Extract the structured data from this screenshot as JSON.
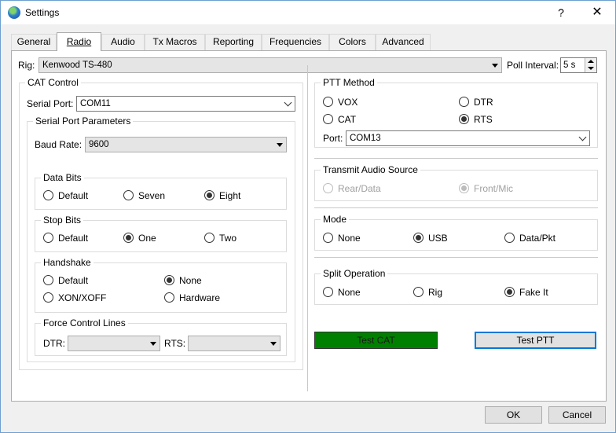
{
  "window": {
    "title": "Settings",
    "help": "?",
    "close": "✕"
  },
  "tabs": [
    "General",
    "Radio",
    "Audio",
    "Tx Macros",
    "Reporting",
    "Frequencies",
    "Colors",
    "Advanced"
  ],
  "rig": {
    "label": "Rig:",
    "value": "Kenwood TS-480"
  },
  "poll": {
    "label": "Poll Interval:",
    "value": "5 s"
  },
  "cat": {
    "title": "CAT Control",
    "serial_port_label": "Serial Port:",
    "serial_port_value": "COM11",
    "params_title": "Serial Port Parameters",
    "baud_label": "Baud Rate:",
    "baud_value": "9600",
    "data_bits": {
      "title": "Data Bits",
      "options": [
        "Default",
        "Seven",
        "Eight"
      ],
      "selected": "Eight"
    },
    "stop_bits": {
      "title": "Stop Bits",
      "options": [
        "Default",
        "One",
        "Two"
      ],
      "selected": "One"
    },
    "handshake": {
      "title": "Handshake",
      "options": [
        "Default",
        "None",
        "XON/XOFF",
        "Hardware"
      ],
      "selected": "None"
    },
    "force": {
      "title": "Force Control Lines",
      "dtr_label": "DTR:",
      "dtr_value": "",
      "rts_label": "RTS:",
      "rts_value": ""
    }
  },
  "ptt": {
    "title": "PTT Method",
    "options": [
      "VOX",
      "DTR",
      "CAT",
      "RTS"
    ],
    "selected": "RTS",
    "port_label": "Port:",
    "port_value": "COM13"
  },
  "tx_audio": {
    "title": "Transmit Audio Source",
    "options": [
      "Rear/Data",
      "Front/Mic"
    ],
    "selected": "Front/Mic"
  },
  "mode": {
    "title": "Mode",
    "options": [
      "None",
      "USB",
      "Data/Pkt"
    ],
    "selected": "USB"
  },
  "split": {
    "title": "Split Operation",
    "options": [
      "None",
      "Rig",
      "Fake It"
    ],
    "selected": "Fake It"
  },
  "buttons": {
    "test_cat": "Test CAT",
    "test_ptt": "Test PTT",
    "ok": "OK",
    "cancel": "Cancel"
  },
  "colors": {
    "test_cat_bg": "#008000",
    "focus_border": "#0078d7"
  }
}
